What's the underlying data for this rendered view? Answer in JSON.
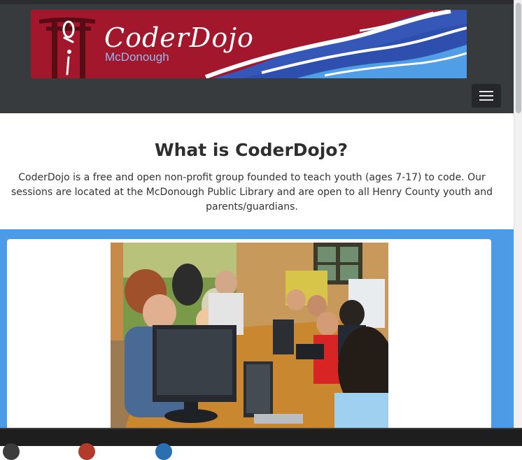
{
  "header": {
    "logo_text": "CoderDojo",
    "logo_subtext": "McDonough",
    "logo_glyph": "ǫi",
    "menu_icon": "hamburger-menu-icon"
  },
  "intro": {
    "title": "What is CoderDojo?",
    "body": "CoderDojo is a free and open non-profit group founded to teach youth (ages 7-17) to code. Our sessions are located at the McDonough Public Library and are open to all Henry County youth and parents/guardians."
  },
  "colors": {
    "navbar": "#383b3e",
    "banner_red": "#a2172b",
    "banner_blue": "#3557b8",
    "section_blue": "#4d9be6",
    "heading": "#2e2e2e"
  },
  "photo": {
    "subject": "children and parents coding on laptops and computers at a library table"
  }
}
